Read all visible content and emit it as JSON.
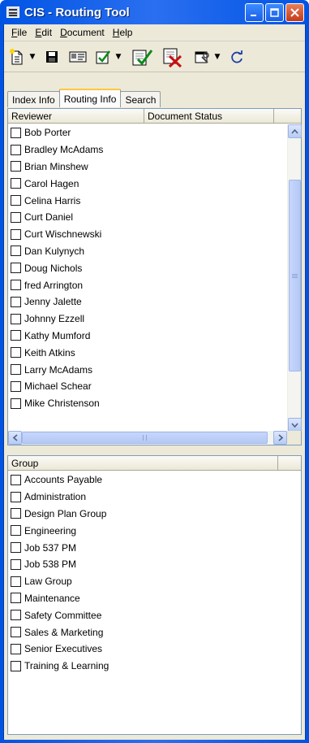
{
  "window": {
    "title": "CIS - Routing Tool"
  },
  "menu": [
    {
      "accel": "F",
      "rest": "ile"
    },
    {
      "accel": "E",
      "rest": "dit"
    },
    {
      "accel": "D",
      "rest": "ocument"
    },
    {
      "accel": "H",
      "rest": "elp"
    }
  ],
  "toolbar": {
    "icons": [
      "new-document-icon",
      "save-icon",
      "card-icon",
      "check-icon",
      "route-check-icon",
      "route-delete-icon",
      "properties-icon",
      "refresh-icon"
    ]
  },
  "tabs": [
    "Index Info",
    "Routing Info",
    "Search"
  ],
  "active_tab": "Routing Info",
  "reviewers": {
    "columns": [
      "Reviewer",
      "Document Status"
    ],
    "rows": [
      "Bob Porter",
      "Bradley McAdams",
      "Brian Minshew",
      "Carol Hagen",
      "Celina Harris",
      "Curt Daniel",
      "Curt Wischnewski",
      "Dan Kulynych",
      "Doug Nichols",
      "fred Arrington",
      "Jenny Jalette",
      "Johnny Ezzell",
      "Kathy Mumford",
      "Keith Atkins",
      "Larry McAdams",
      "Michael Schear",
      "Mike Christenson"
    ]
  },
  "groups": {
    "columns": [
      "Group"
    ],
    "rows": [
      "Accounts Payable",
      "Administration",
      "Design Plan Group",
      "Engineering",
      "Job 537 PM",
      "Job 538 PM",
      "Law Group",
      "Maintenance",
      "Safety Committee",
      "Sales & Marketing",
      "Senior Executives",
      "Training & Learning"
    ]
  }
}
